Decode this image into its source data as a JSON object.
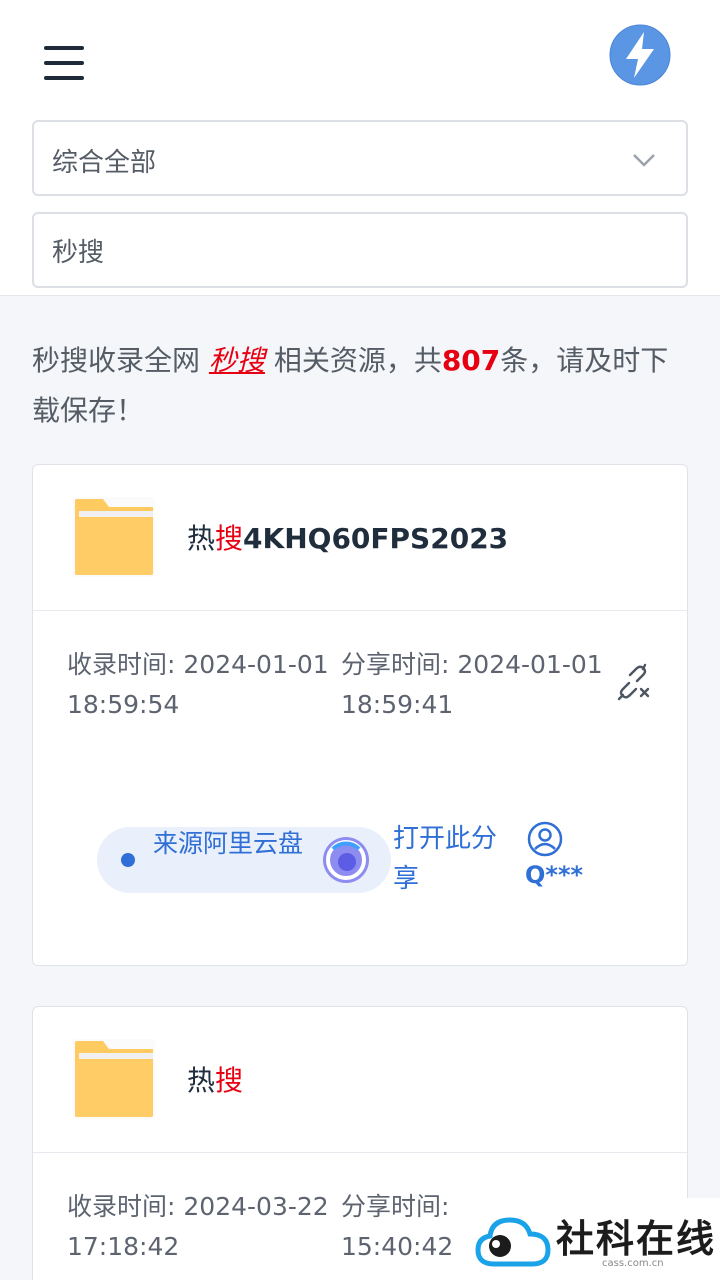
{
  "header": {
    "category_select": "综合全部",
    "search_value": "秒搜"
  },
  "summary": {
    "prefix": "秒搜收录全网 ",
    "keyword": "秒搜",
    "middle": " 相关资源，共",
    "count": "807",
    "suffix": "条，请及时下载保存！"
  },
  "results": [
    {
      "title_pre": "热",
      "title_hl": "搜",
      "title_rest": "4KHQ60FPS2023",
      "index_label": "收录时间:",
      "index_time": "2024-01-01 18:59:54",
      "share_label": "分享时间:",
      "share_time": "2024-01-01 18:59:41",
      "source": "来源阿里云盘",
      "open_label": "打开此分享",
      "user": "Q***"
    },
    {
      "title_pre": "热",
      "title_hl": "搜",
      "title_rest": "",
      "index_label": "收录时间:",
      "index_time": "2024-03-22 17:18:42",
      "share_label": "分享时间:",
      "share_time": "15:40:42"
    }
  ],
  "watermark": {
    "text": "社科在线",
    "sub": "cass.com.cn"
  },
  "colors": {
    "accent": "#2f6fd6",
    "highlight": "#e60012",
    "folder": "#ffca5f"
  }
}
